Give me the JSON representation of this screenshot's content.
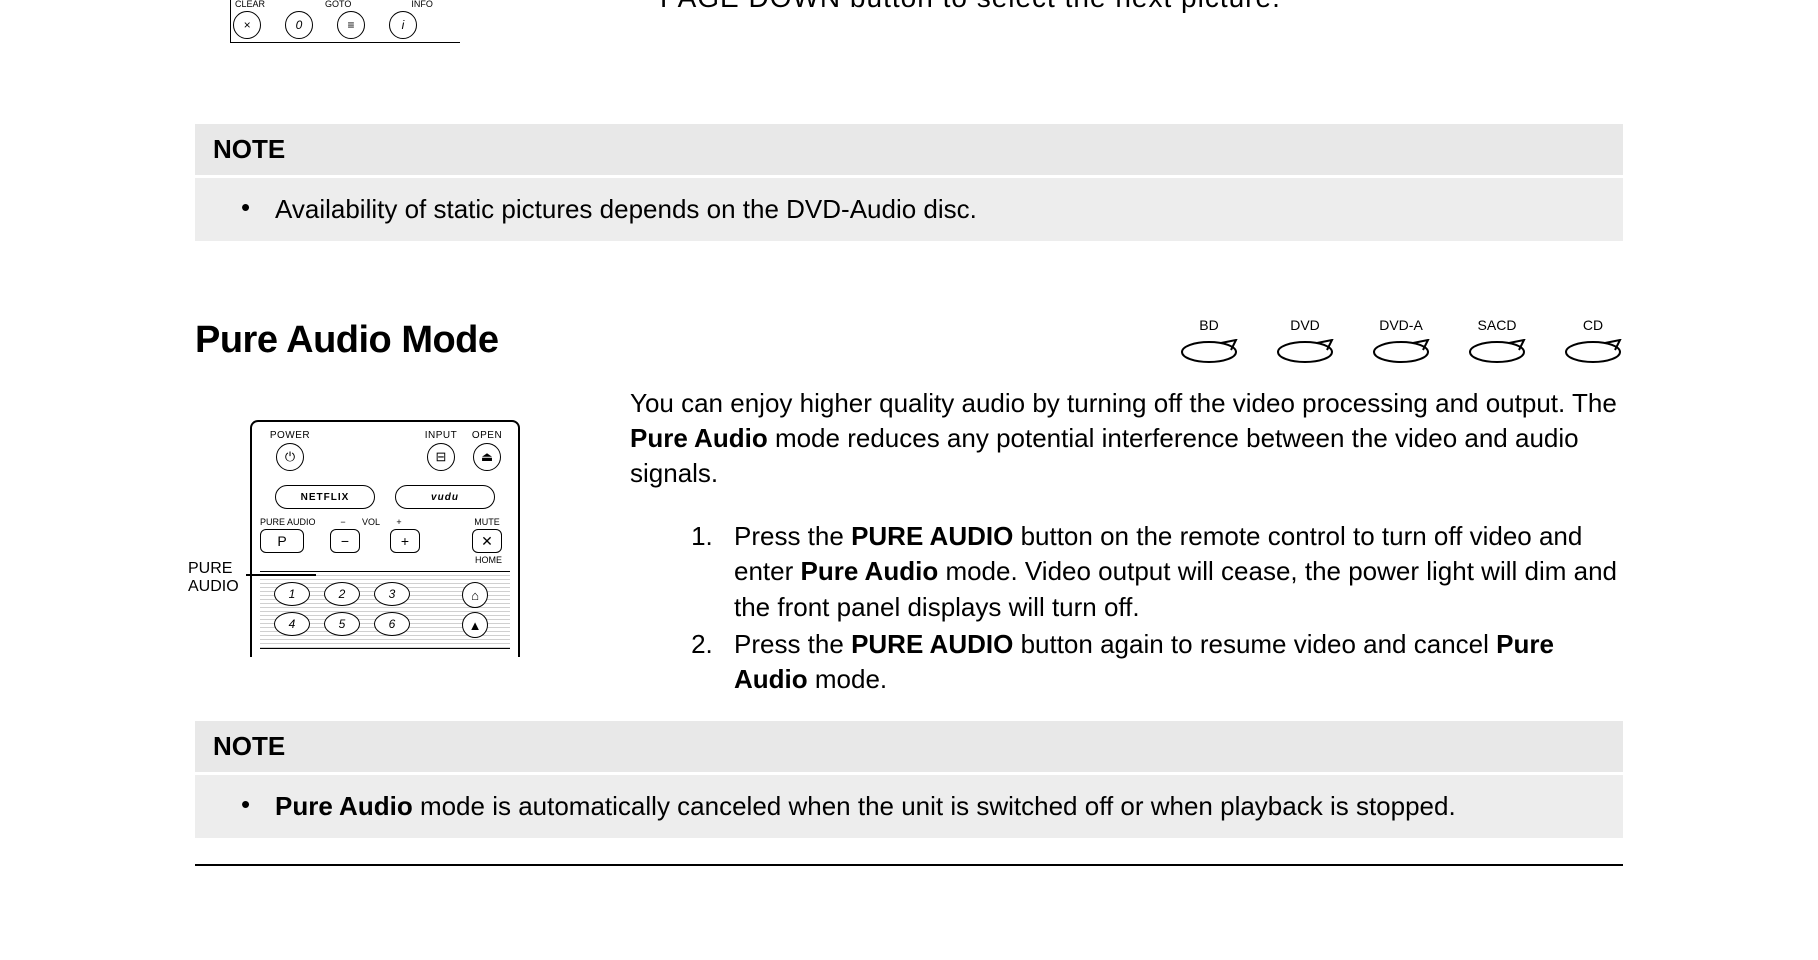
{
  "top_fragment": {
    "partial_line": "PAGE DOWN button to select the next picture.",
    "remote_fragment": {
      "labels": [
        "CLEAR",
        "GOTO",
        "INFO"
      ],
      "buttons": [
        "×",
        "0",
        "≡",
        "i"
      ]
    }
  },
  "note1": {
    "header": "NOTE",
    "bullet": "•",
    "text": "Availability of static pictures depends on the DVD-Audio disc."
  },
  "section": {
    "title": "Pure Audio Mode",
    "discs": [
      "BD",
      "DVD",
      "DVD-A",
      "SACD",
      "CD"
    ],
    "intro_pre": "You can enjoy higher quality audio by turning off the video processing and output. The ",
    "intro_bold": "Pure Audio",
    "intro_post": " mode reduces any potential interference between the video and audio signals.",
    "steps": [
      {
        "segments": [
          {
            "t": "Press the "
          },
          {
            "t": "PURE AUDIO",
            "b": true
          },
          {
            "t": " button on the remote control to turn off video and enter "
          },
          {
            "t": "Pure Audio",
            "b": true
          },
          {
            "t": " mode. Video output will cease, the power light will dim and the front panel displays will turn off."
          }
        ]
      },
      {
        "segments": [
          {
            "t": "Press the "
          },
          {
            "t": "PURE AUDIO",
            "b": true
          },
          {
            "t": " button again to resume video and cancel "
          },
          {
            "t": "Pure Audio",
            "b": true
          },
          {
            "t": " mode."
          }
        ]
      }
    ],
    "remote": {
      "callout_label": "PURE AUDIO",
      "row1_labels": [
        "POWER",
        "INPUT",
        "OPEN"
      ],
      "row1_btns": [
        "⏻",
        "⊟",
        "⏏"
      ],
      "row2_pills": [
        "NETFLIX",
        "vudu"
      ],
      "row3_labels_left": "PURE AUDIO",
      "row3_vol_minus": "−",
      "row3_vol_label": "VOL",
      "row3_vol_plus": "+",
      "row3_mute_label": "MUTE",
      "row3_pure_btn": "P",
      "row3_mute_btn": "✕",
      "row4_home": "HOME",
      "nums_row1": [
        "1",
        "2",
        "3"
      ],
      "nums_row1_extra": "⌂",
      "nums_row2": [
        "4",
        "5",
        "6"
      ],
      "nums_row2_extra": "▲"
    }
  },
  "note2": {
    "header": "NOTE",
    "bullet": "•",
    "pre_bold": "Pure Audio",
    "post": " mode is automatically canceled when the unit is switched off or when playback is stopped."
  }
}
